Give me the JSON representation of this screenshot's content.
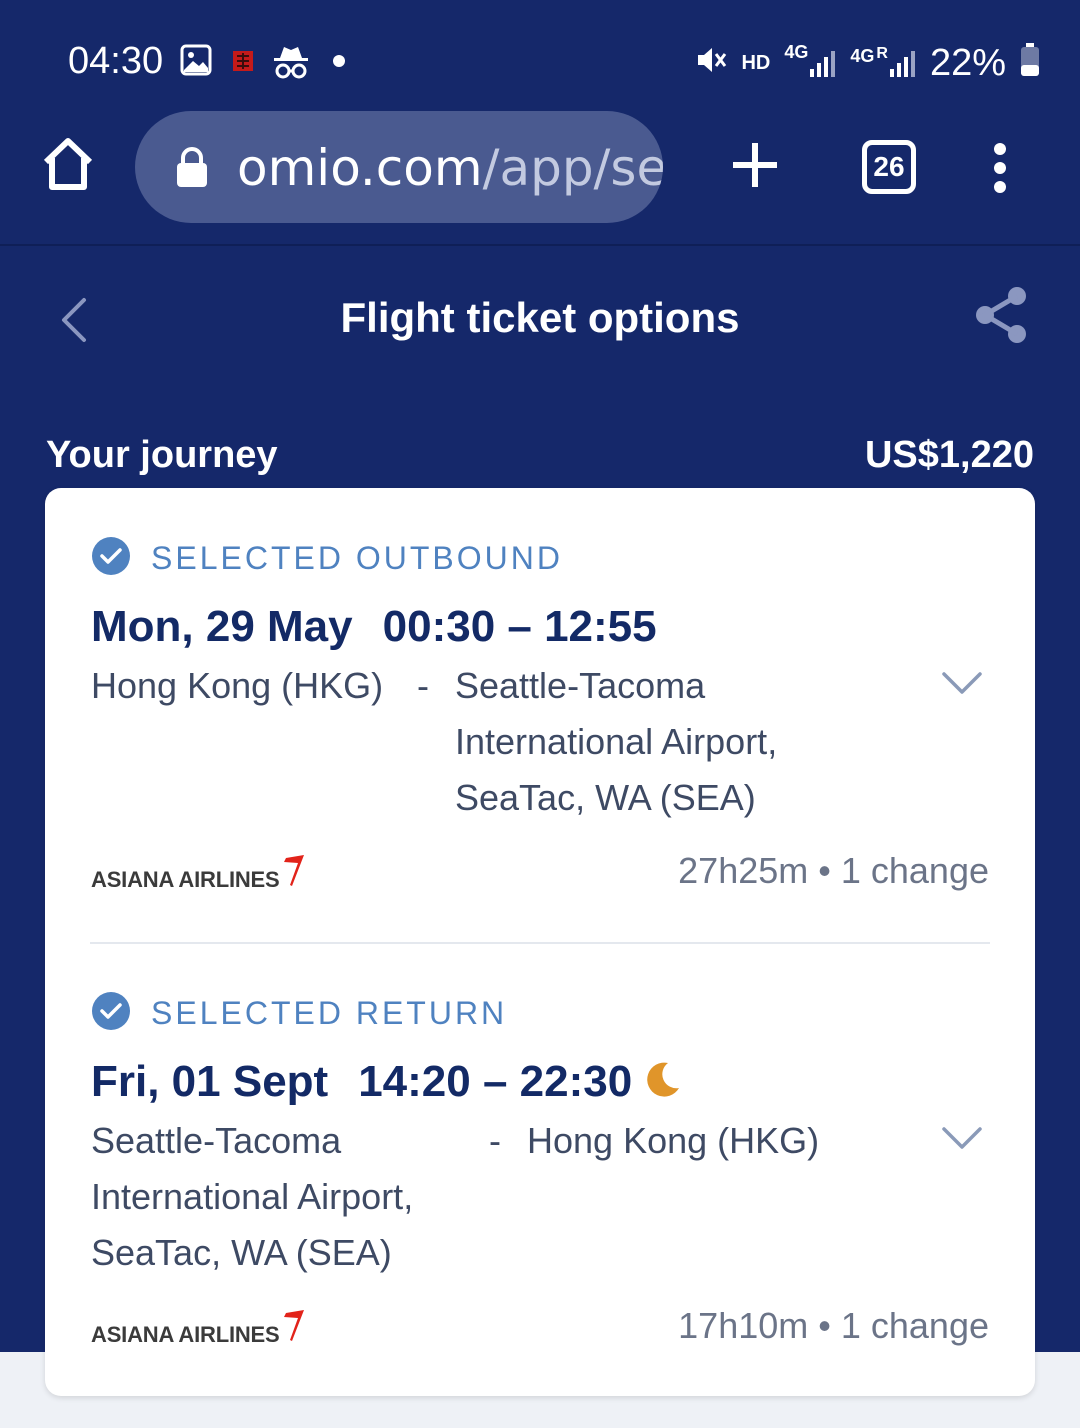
{
  "status_bar": {
    "time": "04:30",
    "network_hd": "HD",
    "network_4g_1": "4G",
    "network_4g_2": "4G",
    "roaming": "R",
    "battery_percent": "22%",
    "icons": [
      "image-icon",
      "app-notification-icon",
      "incognito-icon",
      "dot-icon",
      "mute-icon",
      "signal-icon",
      "battery-icon"
    ]
  },
  "browser": {
    "url_domain": "omio.com",
    "url_path": "/app/se",
    "tab_count": "26",
    "icons": [
      "home-icon",
      "lock-icon",
      "new-tab-icon",
      "tabs-icon",
      "menu-icon"
    ]
  },
  "header": {
    "title": "Flight ticket options",
    "icons": [
      "back-icon",
      "share-icon"
    ]
  },
  "journey": {
    "label": "Your journey",
    "price": "US$1,220"
  },
  "legs": [
    {
      "selected_label": "SELECTED OUTBOUND",
      "date": "Mon, 29 May",
      "times": "00:30 – 12:55",
      "from": "Hong Kong (HKG)",
      "separator": "-",
      "to_lines": [
        "Seattle-Tacoma",
        "International Airport,",
        "SeaTac, WA (SEA)"
      ],
      "airline": "ASIANA AIRLINES",
      "duration": "27h25m • 1 change"
    },
    {
      "selected_label": "SELECTED RETURN",
      "date": "Fri, 01 Sept",
      "times": "14:20 – 22:30",
      "overnight_icon": "moon-icon",
      "from_lines": [
        "Seattle-Tacoma",
        "International Airport,",
        "SeaTac, WA (SEA)"
      ],
      "separator": "-",
      "to": "Hong Kong (HKG)",
      "airline": "ASIANA AIRLINES",
      "duration": "17h10m • 1 change"
    }
  ],
  "colors": {
    "header_bg": "#15286a",
    "accent_blue": "#4f82c0",
    "text_dark": "#132a66",
    "moon": "#e0952a",
    "airline_red": "#e2231a"
  }
}
